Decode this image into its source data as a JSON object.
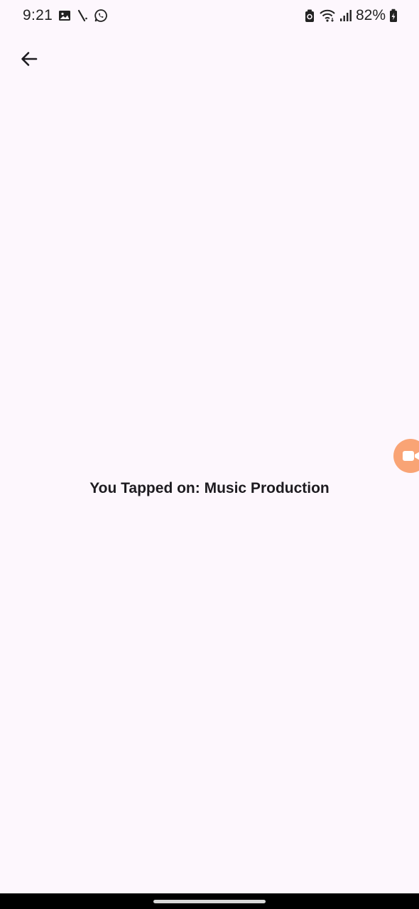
{
  "status_bar": {
    "time": "9:21",
    "battery": "82%",
    "left_icons": [
      "image-icon",
      "signal-slash-icon",
      "whatsapp-icon"
    ],
    "right_icons": [
      "battery-saver-icon",
      "wifi-icon",
      "cellular-signal-icon",
      "battery-charging-icon"
    ]
  },
  "app_bar": {
    "back_icon": "arrow-back-icon"
  },
  "main": {
    "message": "You Tapped on: Music Production"
  },
  "floating_bubble": {
    "icon": "video-camera-icon",
    "color": "#f9a475"
  },
  "colors": {
    "background": "#fdf7fd",
    "text": "#1d1b20",
    "nav_bar": "#000000"
  }
}
